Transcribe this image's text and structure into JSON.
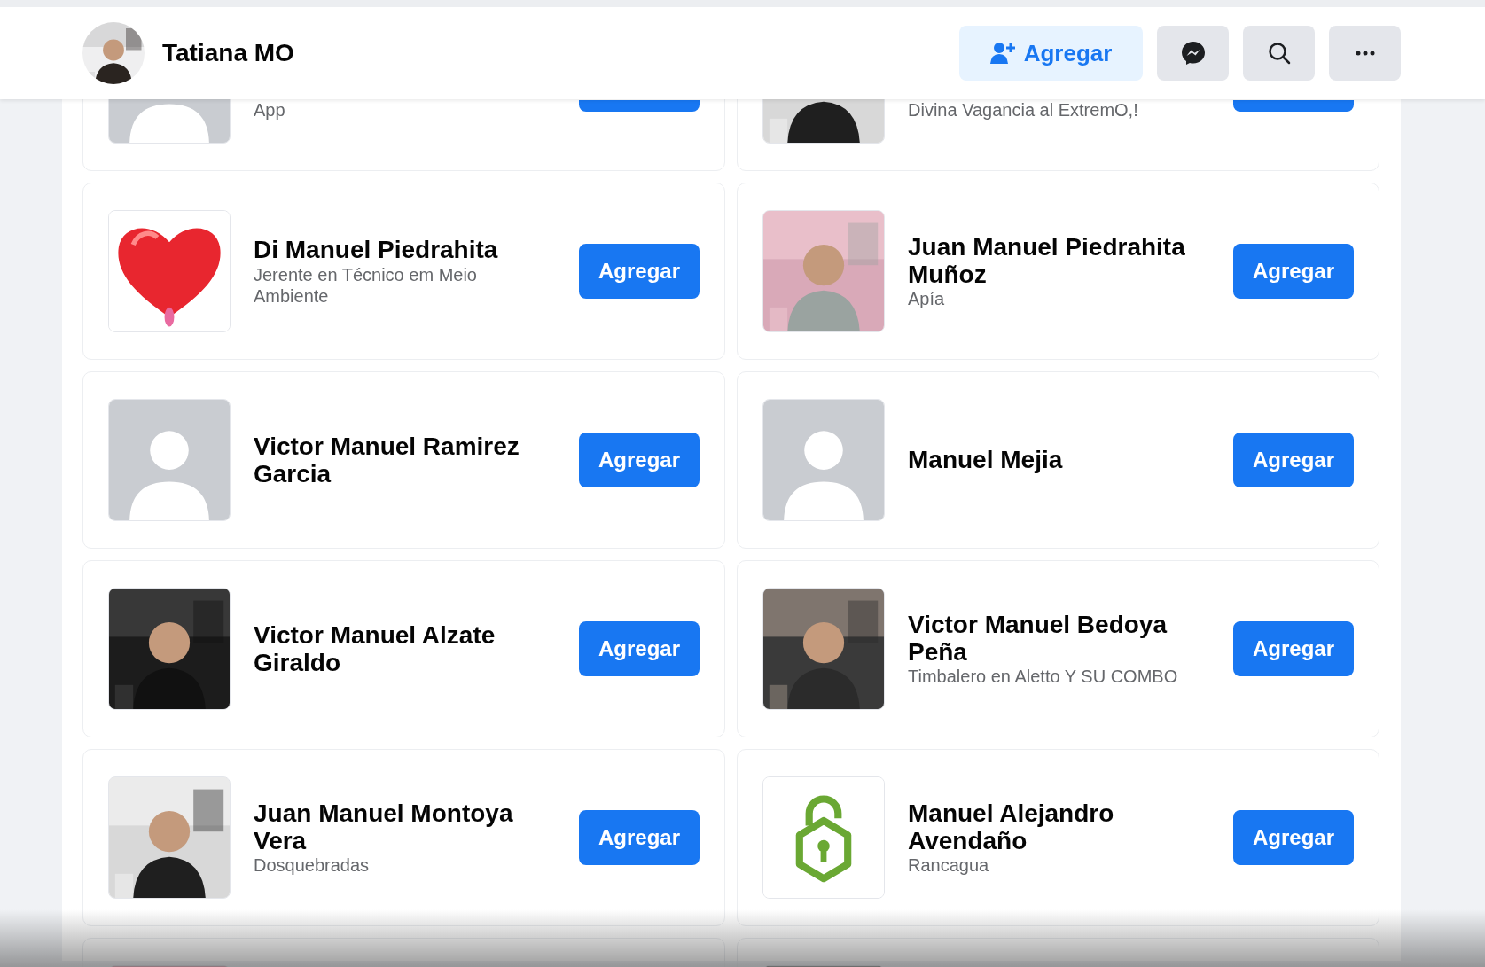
{
  "header": {
    "name": "Tatiana MO",
    "add_button": "Agregar"
  },
  "people": [
    {
      "kind": "silhouette",
      "clipped": true,
      "subtitle": "App"
    },
    {
      "kind": "picture",
      "clipped": true,
      "subtitle": "Divina Vagancia al ExtremO,!"
    },
    {
      "kind": "heart",
      "name": "Di Manuel Piedrahita",
      "subtitle": "Jerente en Técnico em Meio Ambiente",
      "button": "Agregar"
    },
    {
      "kind": "picture",
      "name": "Juan Manuel Piedrahita Muñoz",
      "subtitle": "Apía",
      "button": "Agregar"
    },
    {
      "kind": "silhouette",
      "name": "Victor Manuel Ramirez Garcia",
      "button": "Agregar"
    },
    {
      "kind": "silhouette",
      "name": "Manuel Mejia",
      "button": "Agregar"
    },
    {
      "kind": "picture",
      "name": "Victor Manuel Alzate Giraldo",
      "button": "Agregar"
    },
    {
      "kind": "picture",
      "name": "Victor Manuel Bedoya Peña",
      "subtitle": "Timbalero en Aletto Y SU COMBO",
      "button": "Agregar"
    },
    {
      "kind": "picture",
      "name": "Juan Manuel Montoya Vera",
      "subtitle": "Dosquebradas",
      "button": "Agregar"
    },
    {
      "kind": "lock",
      "name": "Manuel Alejandro Avendaño",
      "subtitle": "Rancagua",
      "button": "Agregar"
    },
    {
      "kind": "picture"
    },
    {
      "kind": "picture"
    }
  ]
}
